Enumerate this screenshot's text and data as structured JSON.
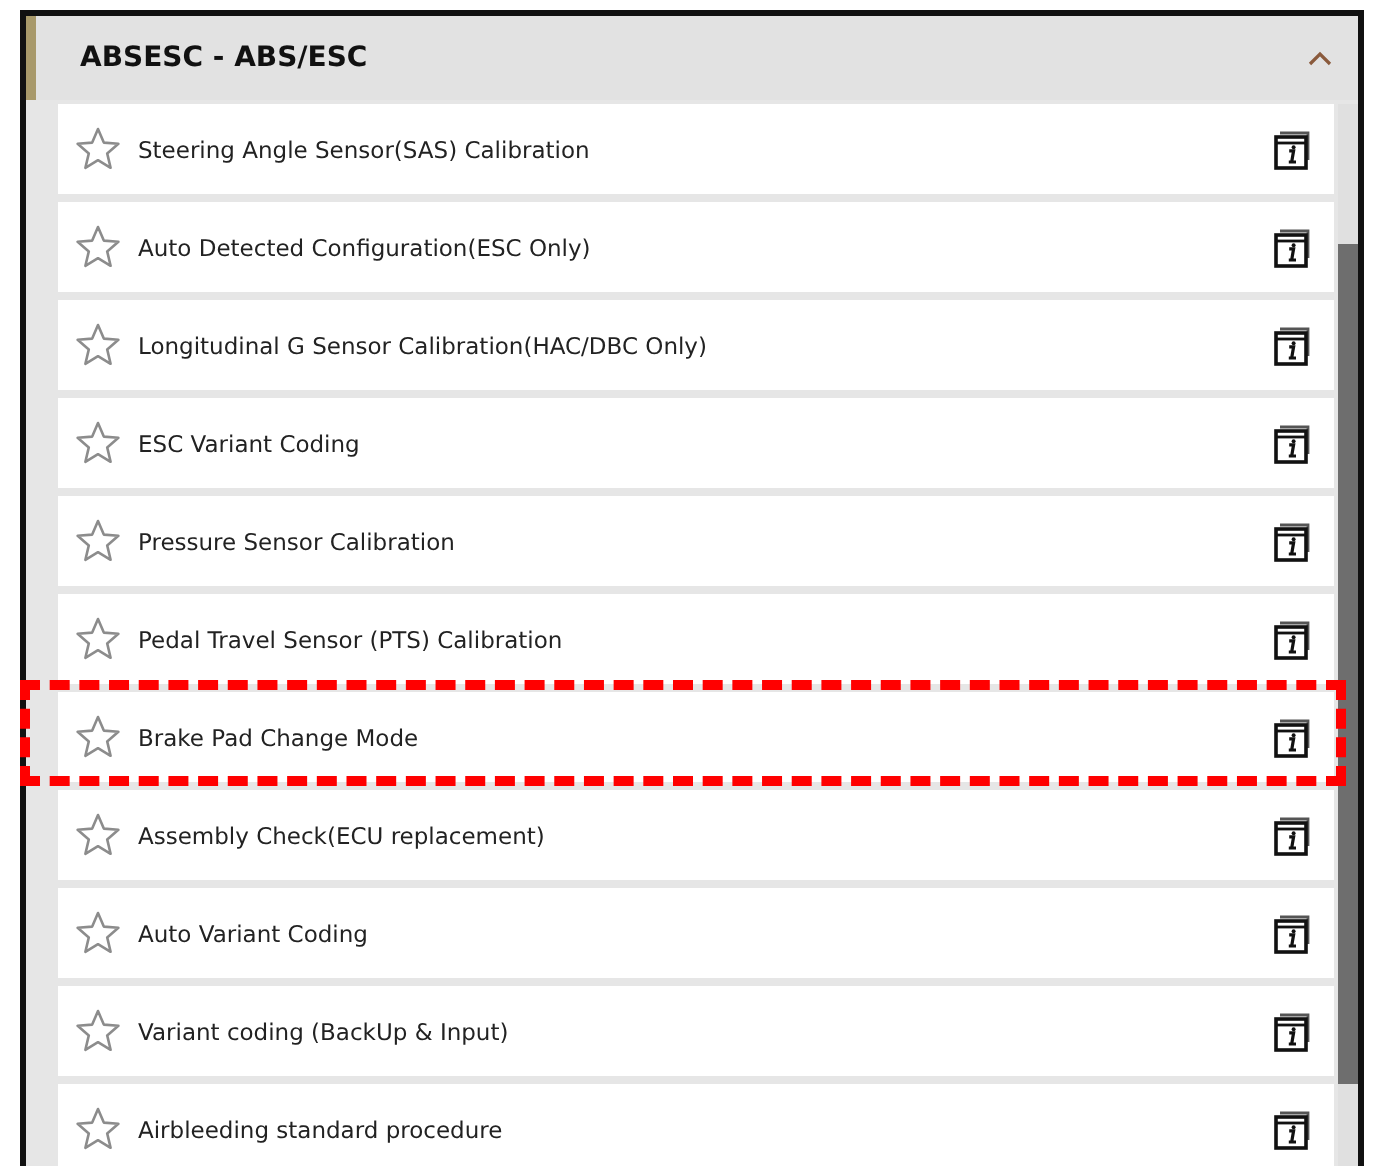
{
  "section": {
    "title": "ABSESC - ABS/ESC",
    "expanded": true
  },
  "items": [
    {
      "label": "Steering Angle Sensor(SAS) Calibration",
      "highlighted": false
    },
    {
      "label": "Auto Detected Configuration(ESC Only)",
      "highlighted": false
    },
    {
      "label": "Longitudinal G Sensor Calibration(HAC/DBC Only)",
      "highlighted": false
    },
    {
      "label": "ESC Variant Coding",
      "highlighted": false
    },
    {
      "label": "Pressure Sensor Calibration",
      "highlighted": false
    },
    {
      "label": "Pedal Travel Sensor (PTS) Calibration",
      "highlighted": false
    },
    {
      "label": "Brake Pad Change Mode",
      "highlighted": true
    },
    {
      "label": "Assembly Check(ECU replacement)",
      "highlighted": false
    },
    {
      "label": "Auto Variant Coding",
      "highlighted": false
    },
    {
      "label": "Variant coding (BackUp & Input)",
      "highlighted": false
    },
    {
      "label": "Airbleeding standard procedure",
      "highlighted": false
    }
  ]
}
